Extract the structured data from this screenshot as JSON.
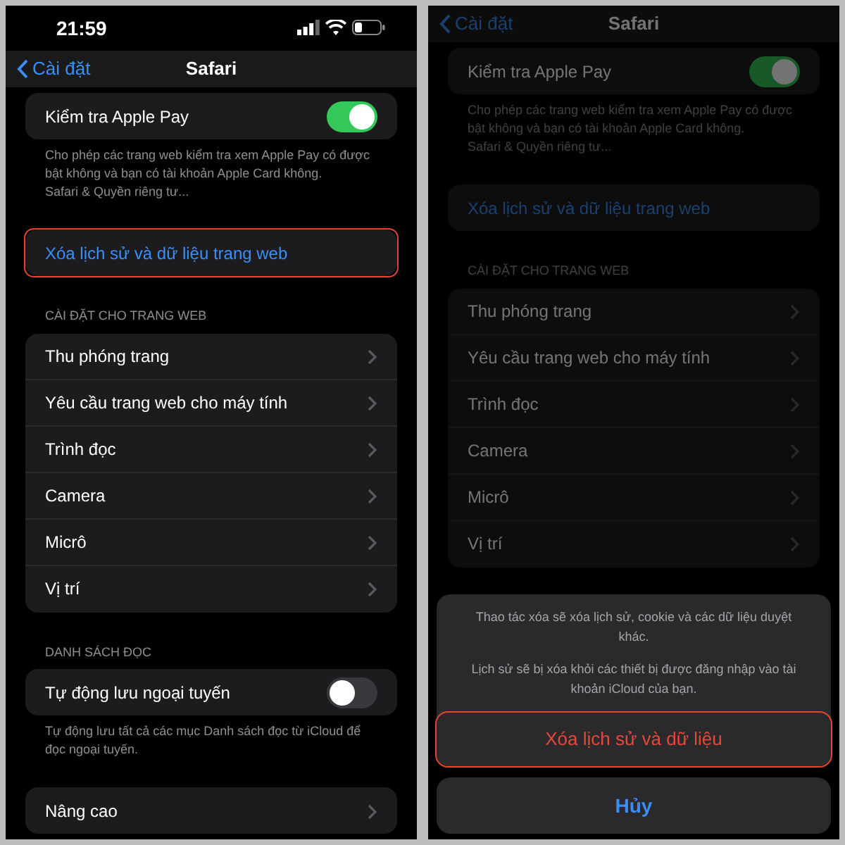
{
  "screens": [
    {
      "dimmed": false,
      "status_bar": {
        "time": "21:59"
      },
      "nav": {
        "back": "Cài đặt",
        "title": "Safari"
      },
      "sections": [
        {
          "rows": [
            {
              "kind": "toggle",
              "label": "Kiểm tra Apple Pay",
              "on": true
            }
          ],
          "footer": "Cho phép các trang web kiểm tra xem Apple Pay có được bật không và bạn có tài khoản Apple Card không.",
          "footer_link": "Safari & Quyền riêng tư..."
        },
        {
          "rows": [
            {
              "kind": "action",
              "label": "Xóa lịch sử và dữ liệu trang web",
              "highlighted": true
            }
          ]
        },
        {
          "header": "CÀI ĐẶT CHO TRANG WEB",
          "rows": [
            {
              "kind": "link",
              "label": "Thu phóng trang"
            },
            {
              "kind": "link",
              "label": "Yêu cầu trang web cho máy tính"
            },
            {
              "kind": "link",
              "label": "Trình đọc"
            },
            {
              "kind": "link",
              "label": "Camera"
            },
            {
              "kind": "link",
              "label": "Micrô"
            },
            {
              "kind": "link",
              "label": "Vị trí"
            }
          ]
        },
        {
          "header": "DANH SÁCH ĐỌC",
          "rows": [
            {
              "kind": "toggle",
              "label": "Tự động lưu ngoại tuyến",
              "on": false
            }
          ],
          "footer": "Tự động lưu tất cả các mục Danh sách đọc từ iCloud để đọc ngoại tuyến."
        },
        {
          "rows": [
            {
              "kind": "link",
              "label": "Nâng cao"
            }
          ]
        }
      ]
    },
    {
      "dimmed": true,
      "nav": {
        "back": "Cài đặt",
        "title": "Safari"
      },
      "sections": [
        {
          "rows": [
            {
              "kind": "toggle",
              "label": "Kiểm tra Apple Pay",
              "on": true
            }
          ],
          "footer": "Cho phép các trang web kiểm tra xem Apple Pay có được bật không và bạn có tài khoản Apple Card không.",
          "footer_link": "Safari & Quyền riêng tư..."
        },
        {
          "rows": [
            {
              "kind": "action",
              "label": "Xóa lịch sử và dữ liệu trang web",
              "highlighted": false
            }
          ]
        },
        {
          "header": "CÀI ĐẶT CHO TRANG WEB",
          "rows": [
            {
              "kind": "link",
              "label": "Thu phóng trang"
            },
            {
              "kind": "link",
              "label": "Yêu cầu trang web cho máy tính"
            },
            {
              "kind": "link",
              "label": "Trình đọc"
            },
            {
              "kind": "link",
              "label": "Camera"
            },
            {
              "kind": "link",
              "label": "Micrô"
            },
            {
              "kind": "link",
              "label": "Vị trí"
            }
          ]
        }
      ],
      "action_sheet": {
        "messages": [
          "Thao tác xóa sẽ xóa lịch sử, cookie và các dữ liệu duyệt khác.",
          "Lịch sử sẽ bị xóa khỏi các thiết bị được đăng nhập vào tài khoản iCloud của bạn."
        ],
        "destructive": {
          "label": "Xóa lịch sử và dữ liệu",
          "highlighted": true
        },
        "cancel": "Hủy"
      }
    }
  ]
}
